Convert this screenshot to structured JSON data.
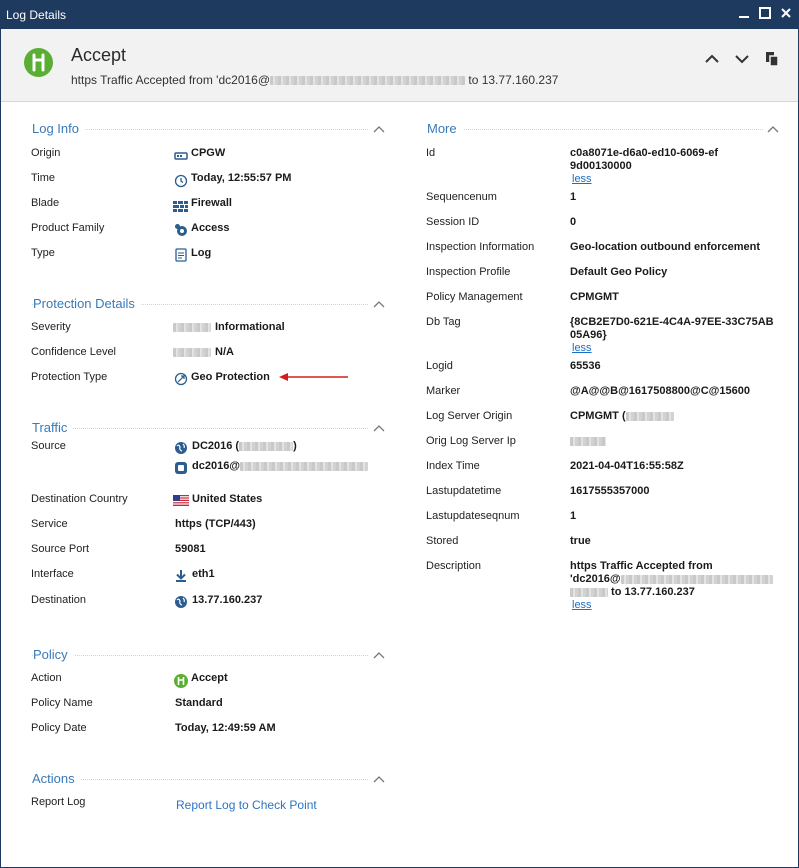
{
  "window": {
    "title": "Log Details"
  },
  "header": {
    "title": "Accept",
    "subtitle_prefix": "https Traffic Accepted from  'dc2016@",
    "subtitle_suffix": " to 13.77.160.237"
  },
  "log_info": {
    "title": "Log Info",
    "rows": [
      {
        "label": "Origin",
        "value": "CPGW",
        "icon": "gateway-icon"
      },
      {
        "label": "Time",
        "value": "Today, 12:55:57 PM",
        "icon": "clock-icon"
      },
      {
        "label": "Blade",
        "value": "Firewall",
        "icon": "firewall-icon"
      },
      {
        "label": "Product Family",
        "value": "Access",
        "icon": "access-icon"
      },
      {
        "label": "Type",
        "value": "Log",
        "icon": "log-icon"
      }
    ]
  },
  "protection": {
    "title": "Protection Details",
    "rows": [
      {
        "label": "Severity",
        "value": "Informational"
      },
      {
        "label": "Confidence Level",
        "value": "N/A"
      },
      {
        "label": "Protection Type",
        "value": "Geo Protection",
        "icon": "geo-icon"
      }
    ]
  },
  "traffic": {
    "title": "Traffic",
    "rows": [
      {
        "label": "Source",
        "value1": "DC2016 (",
        "value1_end": ")",
        "value2": "dc2016@"
      },
      {
        "label": "Destination Country",
        "value": "United States",
        "icon": "us-flag-icon"
      },
      {
        "label": "Service",
        "value": "https (TCP/443)"
      },
      {
        "label": "Source Port",
        "value": "59081"
      },
      {
        "label": "Interface",
        "value": "eth1",
        "icon": "download-arrow-icon"
      },
      {
        "label": "Destination",
        "value": "13.77.160.237",
        "icon": "globe-icon"
      }
    ]
  },
  "policy": {
    "title": "Policy",
    "rows": [
      {
        "label": "Action",
        "value": "Accept",
        "icon": "accept-icon"
      },
      {
        "label": "Policy Name",
        "value": "Standard"
      },
      {
        "label": "Policy Date",
        "value": "Today, 12:49:59 AM"
      }
    ]
  },
  "actions": {
    "title": "Actions",
    "rows": [
      {
        "label": "Report Log",
        "value": "Report Log to Check Point"
      }
    ]
  },
  "more": {
    "title": "More",
    "less": "less",
    "rows": [
      {
        "label": "Id",
        "value": "c0a8071e-d6a0-ed10-6069-ef9d00130000"
      },
      {
        "label": "Sequencenum",
        "value": "1"
      },
      {
        "label": "Session ID",
        "value": "0"
      },
      {
        "label": "Inspection Information",
        "value": "Geo-location outbound enforcement"
      },
      {
        "label": "Inspection Profile",
        "value": "Default Geo Policy"
      },
      {
        "label": "Policy Management",
        "value": "CPMGMT"
      },
      {
        "label": "Db Tag",
        "value": "{8CB2E7D0-621E-4C4A-97EE-33C75AB05A96}"
      },
      {
        "label": "Logid",
        "value": "65536"
      },
      {
        "label": "Marker",
        "value": "@A@@B@1617508800@C@15600"
      },
      {
        "label": "Log Server Origin",
        "value": "CPMGMT (",
        "value_end": ")"
      },
      {
        "label": "Orig Log Server Ip",
        "value": ""
      },
      {
        "label": "Index Time",
        "value": "2021-04-04T16:55:58Z"
      },
      {
        "label": "Lastupdatetime",
        "value": "1617555357000"
      },
      {
        "label": "Lastupdateseqnum",
        "value": "1"
      },
      {
        "label": "Stored",
        "value": "true"
      },
      {
        "label": "Description",
        "value_line1": "https Traffic Accepted from",
        "value_line2": "'dc2016@",
        "value_line3": " to 13.77.160.237"
      }
    ]
  },
  "colors": {
    "titlebar": "#1f3a5f",
    "accent": "#3a79b8",
    "accept_green": "#5aae33",
    "link": "#1c6fc7"
  }
}
